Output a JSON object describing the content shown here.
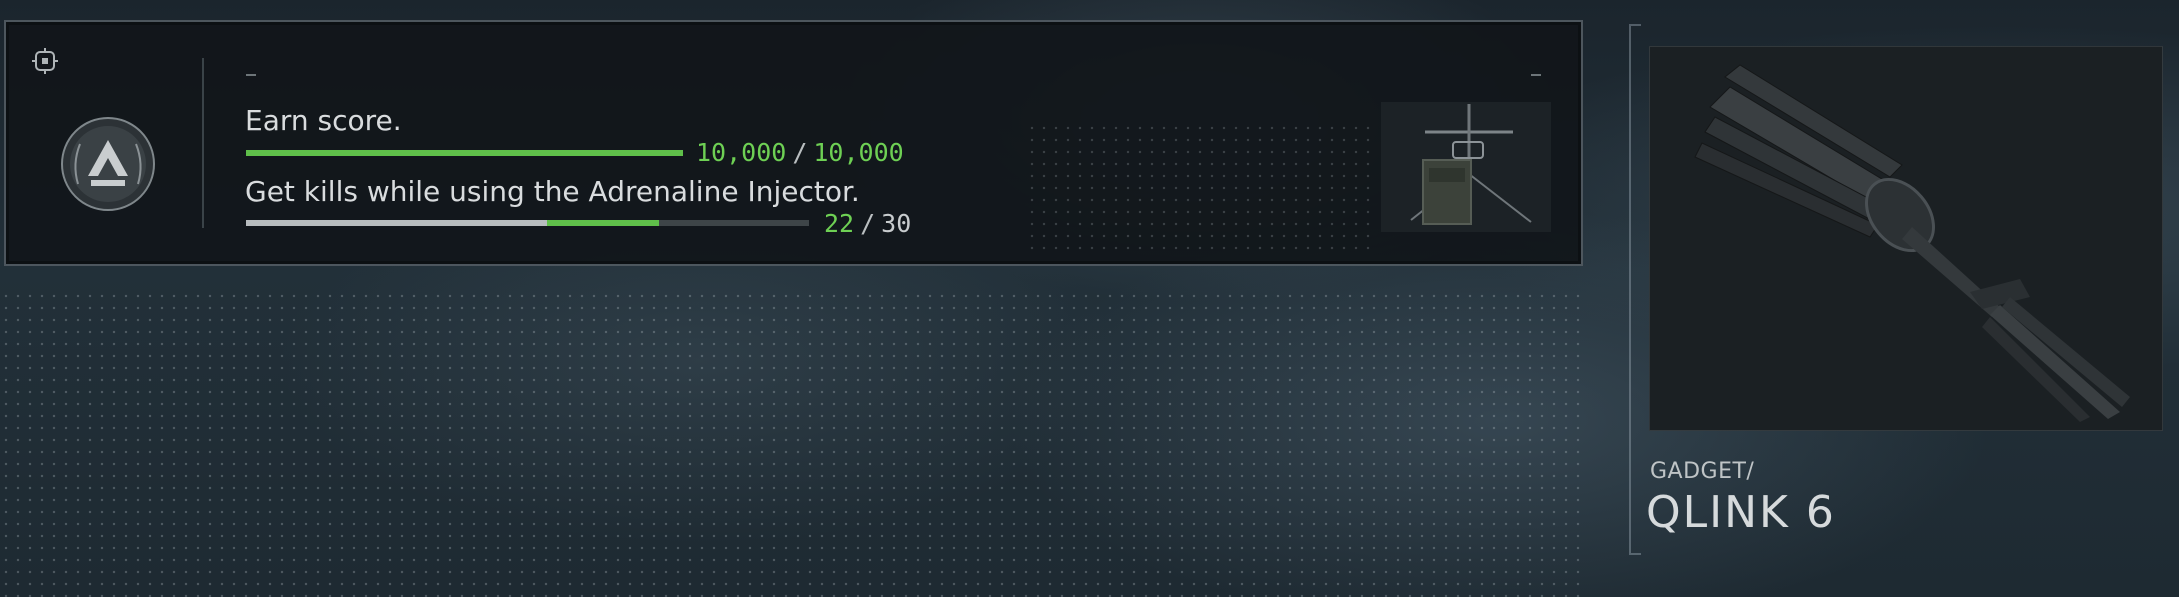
{
  "challenge": {
    "tasks": [
      {
        "label": "Earn score.",
        "current": "10,000",
        "separator": "/",
        "total": "10,000",
        "progress_prior": 0,
        "progress_complete": 1.0
      },
      {
        "label": "Get kills while using the Adrenaline Injector.",
        "current": "22",
        "separator": "/",
        "total": "30",
        "progress_prior": 0.535,
        "progress_complete": 0.733
      }
    ],
    "icons": {
      "corner": "target-icon",
      "emblem": "laurel-chevron-emblem",
      "reward": "gadget-reward-thumbnail"
    },
    "colors": {
      "accent_green": "#6ed054",
      "bar_grey": "#b7bcbe",
      "border": "#8a99a3"
    }
  },
  "gadget": {
    "category": "GADGET/",
    "name": "QLINK 6",
    "image_icon": "qlink-device-image"
  }
}
